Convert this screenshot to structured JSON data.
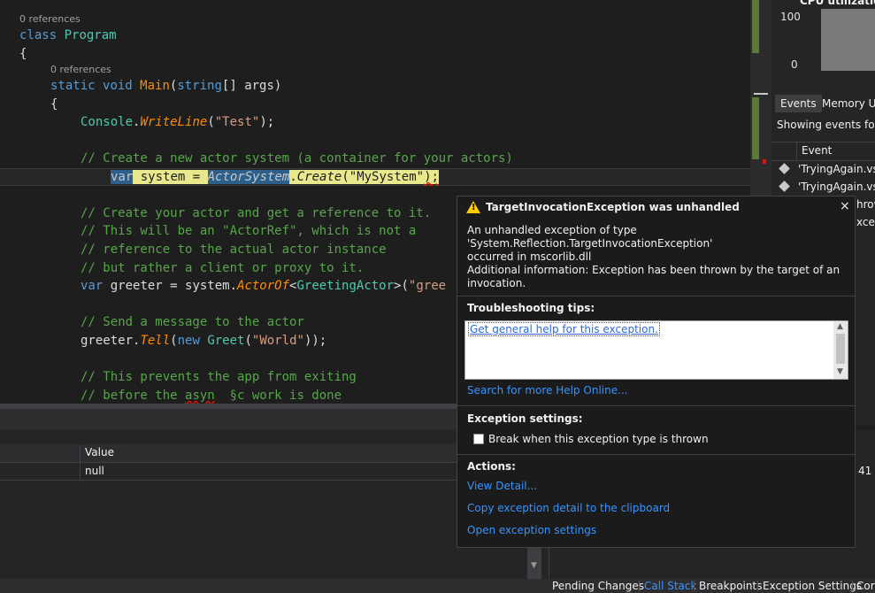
{
  "editor": {
    "ref_class": "0 references",
    "ref_main": "0 references",
    "l_class_kw": "class",
    "l_class_name": "Program",
    "l_open1": "{",
    "l_main_static": "static",
    "l_main_void": "void",
    "l_main_name": "Main",
    "l_main_paren": "(",
    "l_main_string": "string",
    "l_main_rest": "[] args)",
    "l_open2": "{",
    "l_console": "Console",
    "l_dot": ".",
    "l_writeline": "WriteLine",
    "l_test_open": "(",
    "l_test_str": "\"Test\"",
    "l_test_close": ");",
    "c1": "// Create a new actor system (a container for your actors)",
    "l_var": "var",
    "l_system_eq": " system = ",
    "l_actorsystem": "ActorSystem",
    "l_dot2": ".",
    "l_create": "Create",
    "l_create_open": "(",
    "l_mysystem": "\"MySystem\"",
    "l_create_close": ");",
    "c2": "// Create your actor and get a reference to it.",
    "c3": "// This will be an \"ActorRef\", which is not a",
    "c4": "// reference to the actual actor instance",
    "c5": "// but rather a client or proxy to it.",
    "l_var2": "var",
    "l_greeter_eq": " greeter = system.",
    "l_actorof": "ActorOf",
    "l_lt": "<",
    "l_greetingactor": "GreetingActor",
    "l_gt_open": ">(",
    "l_gree": "\"gree",
    "c6": "// Send a message to the actor",
    "l_greeter": "greeter.",
    "l_tell": "Tell",
    "l_tell_open": "(",
    "l_new": "new",
    "l_sp": " ",
    "l_greet": "Greet",
    "l_greet_open": "(",
    "l_world": "\"World\"",
    "l_greet_close": "));",
    "c7": "// This prevents the app from exiting",
    "c8a": "// before the ",
    "c8b": "asyn",
    "c8c": "  §c",
    "c8d": " work is done"
  },
  "diag": {
    "cpu_title": "CPU utilization",
    "cpu_max": "100",
    "cpu_min": "0",
    "tab_events": "Events",
    "tab_memory": "Memory Us",
    "showing": "Showing events for:",
    "col_event": "Event",
    "events": [
      "'TryingAgain.vsh",
      "'TryingAgain.vsh"
    ],
    "partial1": "hrow",
    "partial2": "xcep"
  },
  "watch": {
    "col_value": "Value",
    "row_value": "null",
    "right_number": "41"
  },
  "bottom_tabs": [
    "Pending Changes",
    "Call Stack",
    "Breakpoints",
    "Exception Settings",
    "Cor"
  ],
  "exception": {
    "title": "TargetInvocationException was unhandled",
    "desc_line1": "An unhandled exception of type 'System.Reflection.TargetInvocationException'",
    "desc_line2": "occurred in mscorlib.dll",
    "info_line1": "Additional information: Exception has been thrown by the target of an",
    "info_line2": "invocation.",
    "tips_label": "Troubleshooting tips:",
    "tip_link": "Get general help for this exception.",
    "search_link": "Search for more Help Online...",
    "settings_label": "Exception settings:",
    "break_label": "Break when this exception type is thrown",
    "actions_label": "Actions:",
    "action_detail": "View Detail...",
    "action_copy": "Copy exception detail to the clipboard",
    "action_open": "Open exception settings",
    "colors": {
      "warning": "#ffcc00",
      "link": "#3794ff"
    }
  }
}
